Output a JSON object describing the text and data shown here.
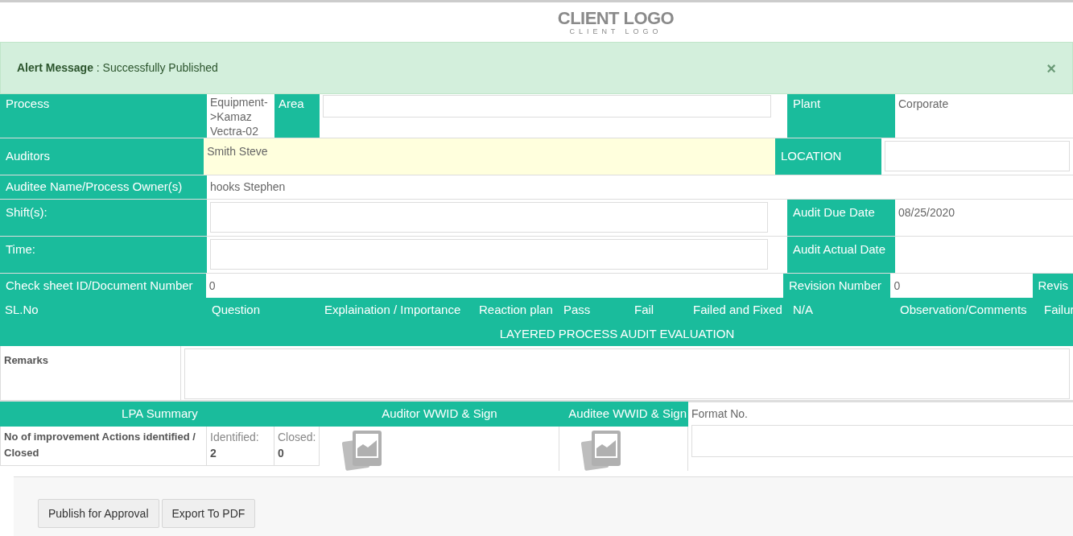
{
  "header": {
    "logo_title": "CLIENT LOGO",
    "logo_subtitle": "CLIENT LOGO"
  },
  "alert": {
    "text": "**Alert Message** : Successfully Published",
    "close": "×"
  },
  "process": {
    "label": "Process",
    "value": "Equipment->Kamaz Vectra-02",
    "area_label": "Area",
    "plant_label": "Plant",
    "plant_value": "Corporate"
  },
  "auditors": {
    "label": "Auditors",
    "value": "Smith Steve",
    "location_label": "LOCATION"
  },
  "auditee": {
    "label": "Auditee Name/Process Owner(s)",
    "value": "hooks Stephen"
  },
  "shift": {
    "label": "Shift(s):",
    "due_label": "Audit Due Date",
    "due_value": "08/25/2020"
  },
  "time": {
    "label": "Time:",
    "actual_label": "Audit Actual Date"
  },
  "check_sheet": {
    "label": "Check sheet ID/Document Number",
    "value": "0",
    "revision_label": "Revision Number",
    "revision_value": "0",
    "column_5": "Revis"
  },
  "evaluation": {
    "columns": [
      "SL.No",
      "Question",
      "Explaination / Importance",
      "Reaction plan",
      "Pass",
      "Fail",
      "Failed and Fixed",
      "N/A",
      "Observation/Comments",
      "Failur"
    ],
    "title": "LAYERED PROCESS AUDIT EVALUATION"
  },
  "remarks": {
    "label": "Remarks"
  },
  "summary": {
    "headers": [
      "LPA Summary",
      "Auditor WWID & Sign",
      "Auditee WWID & Sign"
    ],
    "format_label": "Format No.",
    "rows": [
      {
        "label": "No of improvement Actions identified / Closed",
        "identified_label": "Identified:",
        "identified": "2",
        "closed_label": "Closed:",
        "closed": "0"
      }
    ]
  },
  "buttons": [
    "Publish for Approval",
    "Export To PDF"
  ]
}
